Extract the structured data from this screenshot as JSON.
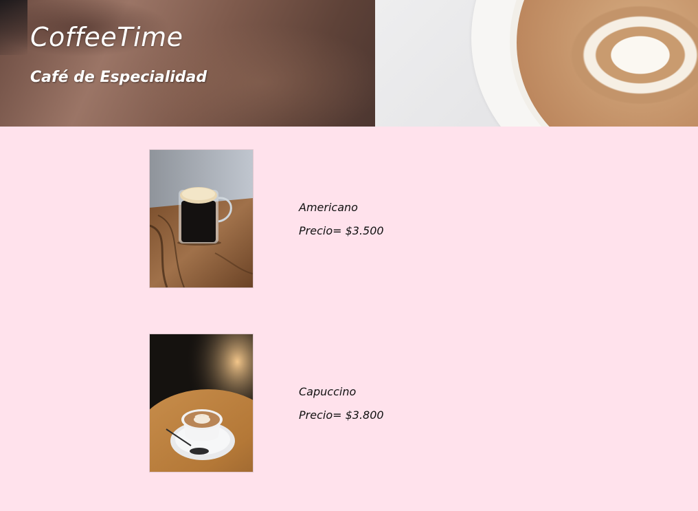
{
  "header": {
    "title": "CoffeeTime",
    "subtitle": "Café de Especialidad"
  },
  "products": [
    {
      "name": "Americano",
      "price": "Precio= $3.500"
    },
    {
      "name": "Capuccino",
      "price": "Precio= $3.800"
    }
  ],
  "colors": {
    "page_background": "#ffe2ec",
    "text": "#111111",
    "hero_text": "#ffffff"
  }
}
